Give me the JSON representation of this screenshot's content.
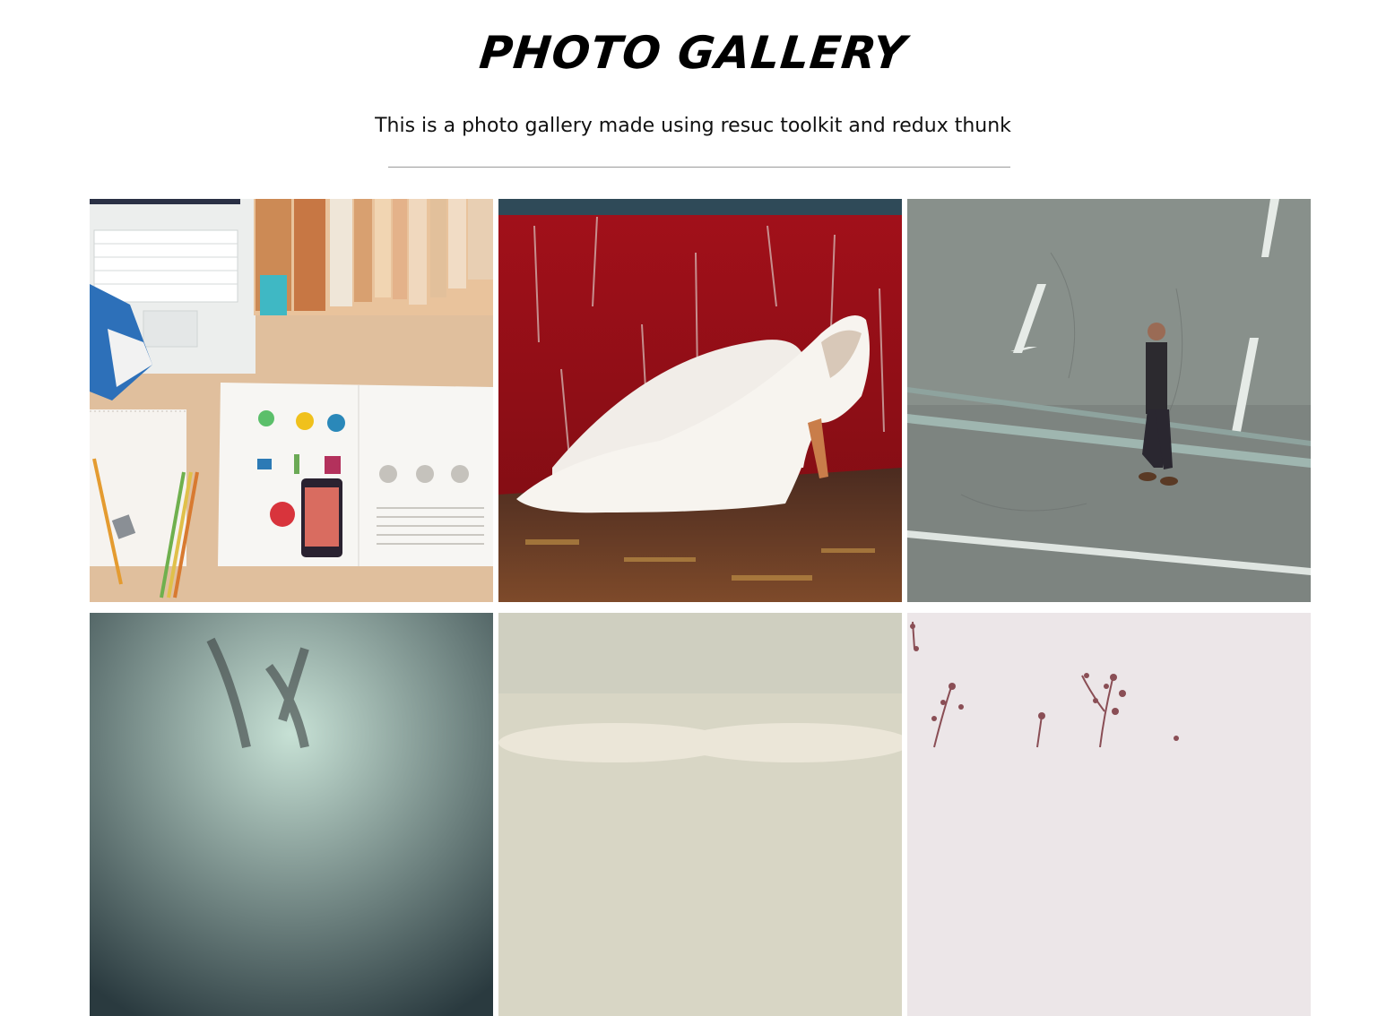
{
  "header": {
    "title": "PHOTO GALLERY",
    "subtitle": "This is a photo gallery made using resuc toolkit and redux thunk"
  },
  "photos": [
    {
      "name": "desk-workspace-photo"
    },
    {
      "name": "white-heels-photo"
    },
    {
      "name": "man-crossing-street-photo"
    },
    {
      "name": "blurred-glasses-photo"
    },
    {
      "name": "open-book-photo"
    },
    {
      "name": "flower-branches-photo"
    }
  ],
  "colors": {
    "background": "#ffffff",
    "text": "#000000",
    "divider": "#9a9a9a"
  }
}
